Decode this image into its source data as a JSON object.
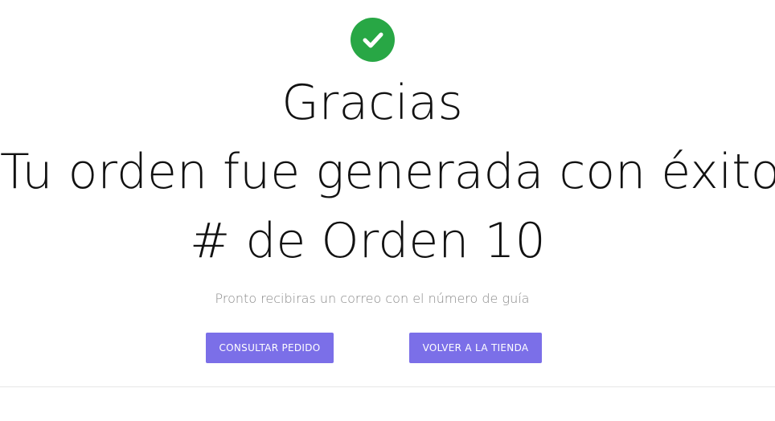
{
  "confirmation": {
    "icon": "check-circle-icon",
    "icon_color": "#28a745",
    "heading": "Gracias",
    "message": "Tu orden fue generada con éxito",
    "order_label": "# de Orden 10",
    "subtitle": "Pronto recibiras un correo con el número de guía"
  },
  "actions": {
    "consultar_label": "CONSULTAR PEDIDO",
    "volver_label": "VOLVER A LA TIENDA",
    "button_color": "#7b6fe8"
  }
}
